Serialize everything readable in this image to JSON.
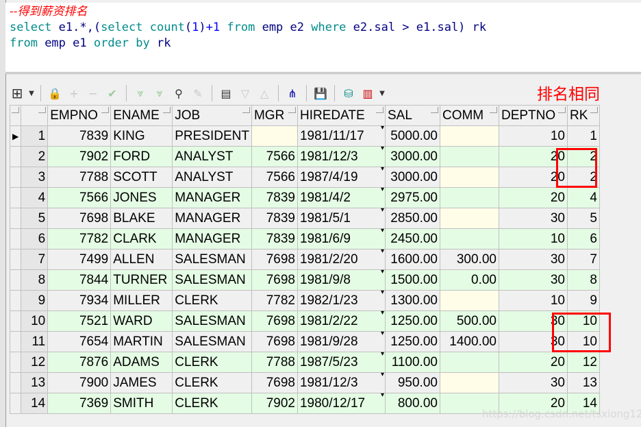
{
  "editor": {
    "comment": "--得到薪资排名",
    "line1": [
      [
        "kw",
        "select "
      ],
      [
        "id",
        "e1.*,("
      ],
      [
        "kw",
        "select "
      ],
      [
        "kw",
        "count"
      ],
      [
        "id",
        "("
      ],
      [
        "nm",
        "1"
      ],
      [
        "id",
        ")"
      ],
      [
        "nm",
        "+1 "
      ],
      [
        "kw",
        "from "
      ],
      [
        "id",
        "emp e2 "
      ],
      [
        "kw",
        "where "
      ],
      [
        "id",
        "e2.sal > e1.sal) rk"
      ]
    ],
    "line2": [
      [
        "kw",
        "from "
      ],
      [
        "id",
        "emp e1 "
      ],
      [
        "kw",
        "order by "
      ],
      [
        "id",
        "rk"
      ]
    ]
  },
  "toolbar": {
    "icons": [
      "grid-layout-icon",
      "dropdown-icon",
      "lock-icon",
      "add-icon",
      "remove-icon",
      "check-icon",
      "next-icon",
      "last-icon",
      "find-icon",
      "clear-icon",
      "export-icon",
      "down-icon",
      "up-icon",
      "tree-icon",
      "save-icon",
      "db-icon",
      "chart-icon",
      "dropdown-icon"
    ]
  },
  "annotation": "排名相同",
  "columns": [
    "EMPNO",
    "ENAME",
    "JOB",
    "MGR",
    "HIREDATE",
    "SAL",
    "COMM",
    "DEPTNO",
    "RK"
  ],
  "rows": [
    [
      "1",
      "7839",
      "KING",
      "PRESIDENT",
      "",
      "1981/11/17",
      "5000.00",
      "",
      "10",
      "1"
    ],
    [
      "2",
      "7902",
      "FORD",
      "ANALYST",
      "7566",
      "1981/12/3",
      "3000.00",
      "",
      "20",
      "2"
    ],
    [
      "3",
      "7788",
      "SCOTT",
      "ANALYST",
      "7566",
      "1987/4/19",
      "3000.00",
      "",
      "20",
      "2"
    ],
    [
      "4",
      "7566",
      "JONES",
      "MANAGER",
      "7839",
      "1981/4/2",
      "2975.00",
      "",
      "20",
      "4"
    ],
    [
      "5",
      "7698",
      "BLAKE",
      "MANAGER",
      "7839",
      "1981/5/1",
      "2850.00",
      "",
      "30",
      "5"
    ],
    [
      "6",
      "7782",
      "CLARK",
      "MANAGER",
      "7839",
      "1981/6/9",
      "2450.00",
      "",
      "10",
      "6"
    ],
    [
      "7",
      "7499",
      "ALLEN",
      "SALESMAN",
      "7698",
      "1981/2/20",
      "1600.00",
      "300.00",
      "30",
      "7"
    ],
    [
      "8",
      "7844",
      "TURNER",
      "SALESMAN",
      "7698",
      "1981/9/8",
      "1500.00",
      "0.00",
      "30",
      "8"
    ],
    [
      "9",
      "7934",
      "MILLER",
      "CLERK",
      "7782",
      "1982/1/23",
      "1300.00",
      "",
      "10",
      "9"
    ],
    [
      "10",
      "7521",
      "WARD",
      "SALESMAN",
      "7698",
      "1981/2/22",
      "1250.00",
      "500.00",
      "30",
      "10"
    ],
    [
      "11",
      "7654",
      "MARTIN",
      "SALESMAN",
      "7698",
      "1981/9/28",
      "1250.00",
      "1400.00",
      "30",
      "10"
    ],
    [
      "12",
      "7876",
      "ADAMS",
      "CLERK",
      "7788",
      "1987/5/23",
      "1100.00",
      "",
      "20",
      "12"
    ],
    [
      "13",
      "7900",
      "JAMES",
      "CLERK",
      "7698",
      "1981/12/3",
      "950.00",
      "",
      "30",
      "13"
    ],
    [
      "14",
      "7369",
      "SMITH",
      "CLERK",
      "7902",
      "1980/12/17",
      "800.00",
      "",
      "20",
      "14"
    ]
  ],
  "watermark": "https://blog.csdn.net/tsxiong123"
}
